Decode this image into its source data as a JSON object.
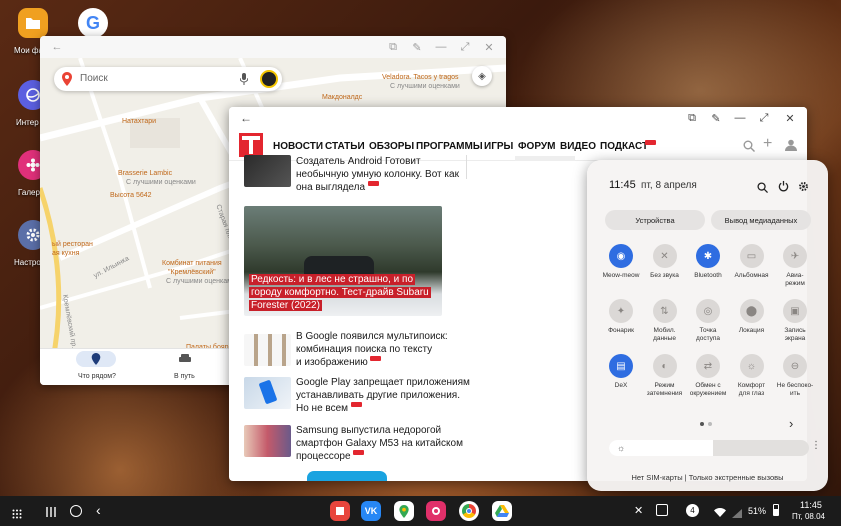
{
  "desktop": {
    "icons": [
      {
        "label": "Мои фа"
      },
      {
        "label": "Интер"
      },
      {
        "label": "Галер"
      },
      {
        "label": "Настро"
      }
    ]
  },
  "maps": {
    "search_placeholder": "Поиск",
    "places": [
      "Veladora. Tacos y tragos",
      "С лучшими оценками",
      "Макдоналдс",
      "Натахтари",
      "Brasserie Lambic",
      "С лучшими оценками",
      "Высота 5642",
      "ый ресторан",
      "ая кухня",
      "ул. Ильинка",
      "Комбинат питания",
      "\"Кремлёвский\"",
      "С лучшими оценками",
      "Палаты бояр",
      "Старая пл.",
      "Кремлёвский пр.",
      "Другие",
      "Китай-город"
    ],
    "tabs": [
      {
        "label": "Что рядом?"
      },
      {
        "label": "В путь"
      }
    ]
  },
  "browser": {
    "nav": [
      "НОВОСТИ",
      "СТАТЬИ",
      "ОБЗОРЫ",
      "ПРОГРАММЫ",
      "ИГРЫ",
      "ФОРУМ",
      "ВИДЕО",
      "ПОДКАСТ"
    ],
    "articles": [
      {
        "lines": [
          "Создатель Android Готовит",
          "необычную умную колонку. Вот как",
          "она выглядела"
        ]
      },
      {
        "lines": [
          "Редкость: и в лес не страшно, и по",
          "городу комфортно. Тест-драйв Subaru",
          "Forester (2022)"
        ]
      },
      {
        "lines": [
          "В Google появился мультипоиск:",
          "комбинация поиска по тексту",
          "и изображению"
        ]
      },
      {
        "lines": [
          "Google Play запрещает приложениям",
          "устанавливать другие приложения.",
          "Но не всем"
        ]
      },
      {
        "lines": [
          "Samsung выпустила недорогой",
          "смартфон Galaxy M53 на китайском",
          "процессоре"
        ]
      }
    ]
  },
  "quick_panel": {
    "time": "11:45",
    "date": "пт, 8 апреля",
    "buttons": [
      "Устройства",
      "Вывод медиаданных"
    ],
    "tiles": [
      {
        "label": "Meow-meow",
        "on": true
      },
      {
        "label": "Без звука",
        "on": false
      },
      {
        "label": "Bluetooth",
        "on": true
      },
      {
        "label": "Альбомная",
        "on": false
      },
      {
        "label": "Авиа-\nрежим",
        "on": false
      },
      {
        "label": "Фонарик",
        "on": false
      },
      {
        "label": "Мобил.\nданные",
        "on": false
      },
      {
        "label": "Точка\nдоступа",
        "on": false
      },
      {
        "label": "Локация",
        "on": false
      },
      {
        "label": "Запись\nэкрана",
        "on": false
      },
      {
        "label": "DeX",
        "on": true
      },
      {
        "label": "Режим\nзатемнения",
        "on": false
      },
      {
        "label": "Обмен с\nокружением",
        "on": false
      },
      {
        "label": "Комфорт\nдля глаз",
        "on": false
      },
      {
        "label": "Не беспоко-\nить",
        "on": false
      }
    ],
    "footer": "Нет SIM-карты | Только экстренные вызовы"
  },
  "taskbar": {
    "notif_count": "4",
    "battery": "51%",
    "time": "11:45",
    "date": "Пт, 08.04"
  },
  "colors": {
    "accent_blue": "#2f6de1",
    "badge_red": "#e3262f",
    "map_label": "#c0681a"
  }
}
